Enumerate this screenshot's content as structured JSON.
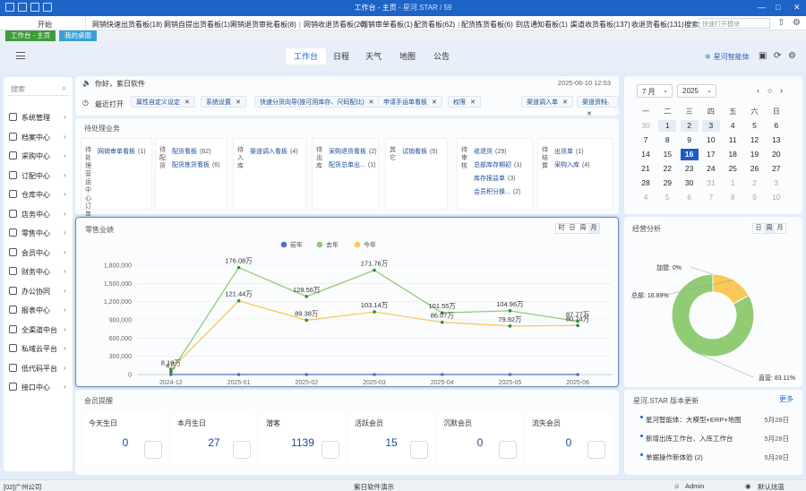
{
  "titlebar": {
    "title": "工作台 - 主页",
    "subtitle": "星河.STAR / 59",
    "controls": [
      "—",
      "□",
      "✕"
    ]
  },
  "tabbar": {
    "start_label": "开始",
    "tabs": [
      {
        "label": "网销快速出货看板(18)"
      },
      {
        "label": "网销自提出货看板(1)"
      },
      {
        "label": "网销退货审批看板(8)"
      },
      {
        "label": "网销收退货看板(20)"
      },
      {
        "label": "网销审单看板(1)"
      },
      {
        "label": "配货看板(62)"
      },
      {
        "label": "配货拣货看板(6)"
      },
      {
        "label": "到店通知看板(1)"
      },
      {
        "label": "渠道收货看板(137)"
      },
      {
        "label": "收退货看板(131)"
      }
    ],
    "search_label": "搜索:",
    "search_placeholder": "快速打开模块"
  },
  "pagetabs": {
    "tab1": "工作台 - 主页",
    "tab2": "我的桌面"
  },
  "nav": {
    "tabs": [
      "工作台",
      "日程",
      "天气",
      "地图",
      "公告"
    ],
    "brand": "星河智能体"
  },
  "sidebar": {
    "search_placeholder": "搜索",
    "items": [
      "系统管理",
      "档案中心",
      "采购中心",
      "订配中心",
      "仓库中心",
      "店务中心",
      "零售中心",
      "会员中心",
      "财务中心",
      "办公协同",
      "报表中心",
      "全渠道中台",
      "私域云平台",
      "低代码平台",
      "接口中心"
    ]
  },
  "recent": {
    "greeting": "你好，紫日软件",
    "datetime": "2025-06-10 12:53",
    "label": "最近打开",
    "chips": [
      "属性自定义设定",
      "系统设置",
      "快速分货向导(按可用库存、尺码配比)",
      "申请手运单看板",
      "权限",
      "渠道调入单",
      "渠道资料"
    ]
  },
  "pending": {
    "title": "待处理业务",
    "columns": [
      {
        "title": "待处理营运中心订单",
        "items": [
          {
            "name": "网销审单看板",
            "count": "(1)"
          }
        ]
      },
      {
        "title": "待配货",
        "items": [
          {
            "name": "配货看板",
            "count": "(62)"
          },
          {
            "name": "配货拣货看板",
            "count": "(6)"
          }
        ]
      },
      {
        "title": "待入库",
        "items": [
          {
            "name": "渠道调入看板",
            "count": "(4)"
          }
        ]
      },
      {
        "title": "待出库",
        "items": [
          {
            "name": "采购退货看板",
            "count": "(2)"
          },
          {
            "name": "配货总单出...",
            "count": "(1)"
          }
        ]
      },
      {
        "title": "其它",
        "items": [
          {
            "name": "试销看板",
            "count": "(5)"
          }
        ]
      },
      {
        "title": "待审核",
        "items": [
          {
            "name": "收退货",
            "count": "(29)"
          },
          {
            "name": "总部库存期初",
            "count": "(1)"
          },
          {
            "name": "库存报益单",
            "count": "(3)"
          },
          {
            "name": "会员积分换...",
            "count": "(2)"
          }
        ]
      },
      {
        "title": "待结算",
        "items": [
          {
            "name": "出货单",
            "count": "(1)"
          },
          {
            "name": "采购入库",
            "count": "(4)"
          }
        ]
      }
    ]
  },
  "sales": {
    "title": "零售业绩",
    "periods": [
      "时",
      "日",
      "周",
      "月"
    ],
    "active_period": "月"
  },
  "chart_data": {
    "type": "line",
    "categories": [
      "2024-12",
      "2025-01",
      "2025-02",
      "2025-03",
      "2025-04",
      "2025-05",
      "2025-06"
    ],
    "ylim": [
      0,
      1800000
    ],
    "yticks": [
      "0",
      "300,000",
      "600,000",
      "900,000",
      "1,200,000",
      "1,500,000",
      "1,800,000"
    ],
    "series": [
      {
        "name": "前年",
        "color": "#5470c6",
        "values": [
          0,
          0,
          0,
          0,
          0,
          0,
          0
        ],
        "labels": [
          "",
          "",
          "",
          "",
          "",
          "",
          ""
        ]
      },
      {
        "name": "去年",
        "color": "#91cc75",
        "values": [
          40000,
          1760800,
          1285600,
          1717600,
          1015500,
          1049600,
          877700
        ],
        "labels": [
          "4万",
          "176.08万",
          "128.56万",
          "171.76万",
          "101.55万",
          "104.96万",
          "87.77万"
        ]
      },
      {
        "name": "今年",
        "color": "#fac858",
        "values": [
          81300,
          1214400,
          893800,
          1031400,
          860700,
          799200,
          807400
        ],
        "labels": [
          "8.13万",
          "121.44万",
          "89.38万",
          "103.14万",
          "86.07万",
          "79.92万",
          "80.74万"
        ]
      }
    ]
  },
  "calendar": {
    "month": "7 月",
    "year": "2025",
    "nav": [
      "‹",
      "○",
      "›"
    ],
    "weekdays": [
      "一",
      "二",
      "三",
      "四",
      "五",
      "六",
      "日"
    ],
    "days": [
      "30",
      "1",
      "2",
      "3",
      "4",
      "5",
      "6",
      "7",
      "8",
      "9",
      "10",
      "11",
      "12",
      "13",
      "14",
      "15",
      "16",
      "17",
      "18",
      "19",
      "20",
      "21",
      "22",
      "23",
      "24",
      "25",
      "26",
      "27",
      "28",
      "29",
      "30",
      "31",
      "1",
      "2",
      "3",
      "4",
      "5",
      "6",
      "7",
      "8",
      "9",
      "10"
    ]
  },
  "analysis": {
    "title": "经营分析",
    "periods": [
      "日",
      "周",
      "月"
    ],
    "active_period": "周",
    "pie": [
      {
        "label": "加盟: 0%",
        "value": 0,
        "color": "#5470c6"
      },
      {
        "label": "总部: 16.89%",
        "value": 16.89,
        "color": "#fac858"
      },
      {
        "label": "直营: 83.11%",
        "value": 83.11,
        "color": "#91cc75"
      }
    ]
  },
  "member": {
    "title": "会员提醒",
    "cards": [
      {
        "label": "今天生日",
        "value": "0"
      },
      {
        "label": "本月生日",
        "value": "27"
      },
      {
        "label": "潜客",
        "value": "1139"
      },
      {
        "label": "活跃会员",
        "value": "15"
      },
      {
        "label": "沉默会员",
        "value": "0"
      },
      {
        "label": "流失会员",
        "value": "0"
      }
    ]
  },
  "news": {
    "title": "星河.STAR 版本更新",
    "more": "更多",
    "items": [
      {
        "text": "星河智能体：大模型+ERP+地图",
        "date": "5月28日"
      },
      {
        "text": "新增出库工作台、入库工作台",
        "date": "5月28日"
      },
      {
        "text": "单据操作新体验 (2)",
        "date": "5月28日"
      }
    ]
  },
  "status": {
    "left": "[02]广州公司",
    "center": "紫日软件演示",
    "user": "Admin",
    "theme": "默认炫蓝"
  }
}
